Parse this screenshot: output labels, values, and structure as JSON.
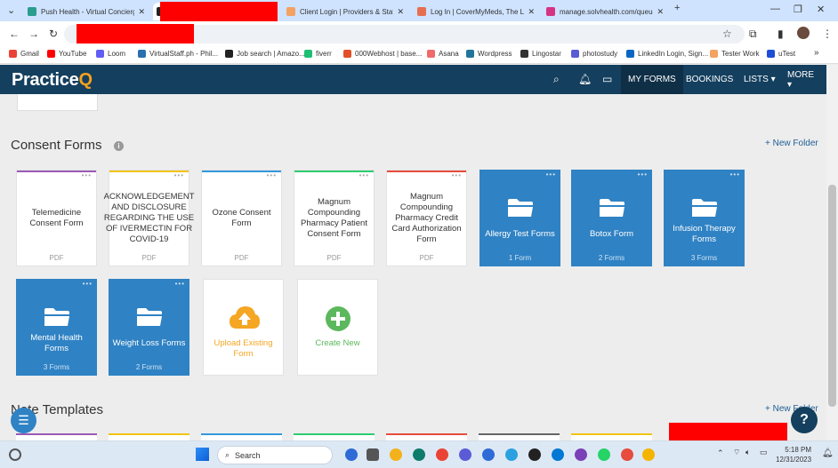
{
  "browser": {
    "tabs": [
      {
        "title": "Push Health - Virtual Concierge",
        "color": "#2a9d8f",
        "active": false
      },
      {
        "title": "",
        "color": "#222222",
        "active": true
      },
      {
        "title": "Client Login | Providers & Staff",
        "color": "#f4a261",
        "active": false
      },
      {
        "title": "Log In | CoverMyMeds, The Lea",
        "color": "#e76f51",
        "active": false
      },
      {
        "title": "manage.solvhealth.com/queue",
        "color": "#d63384",
        "active": false
      }
    ],
    "new_tab": "+",
    "bookmarks": [
      {
        "label": "Gmail",
        "color": "#ea4335"
      },
      {
        "label": "YouTube",
        "color": "#ff0000"
      },
      {
        "label": "Loom",
        "color": "#625df5"
      },
      {
        "label": "VirtualStaff.ph - Phil...",
        "color": "#2a6fb0"
      },
      {
        "label": "Job search | Amazo...",
        "color": "#222222"
      },
      {
        "label": "fiverr",
        "color": "#1dbf73"
      },
      {
        "label": "000Webhost | base...",
        "color": "#e34f26"
      },
      {
        "label": "Asana",
        "color": "#f06a6a"
      },
      {
        "label": "Wordpress",
        "color": "#21759b"
      },
      {
        "label": "Lingostar",
        "color": "#333333"
      },
      {
        "label": "photostudy",
        "color": "#5b5bd6"
      },
      {
        "label": "LinkedIn Login, Sign...",
        "color": "#0a66c2"
      },
      {
        "label": "Tester Work",
        "color": "#f4a261"
      },
      {
        "label": "uTest",
        "color": "#1c4fd6"
      }
    ],
    "bookmarks_more": "»"
  },
  "app": {
    "logo_main": "Practice",
    "logo_accent": "Q",
    "nav": [
      "MY FORMS",
      "BOOKINGS",
      "LISTS ▾",
      "MORE ▾"
    ],
    "active_nav": "MY FORMS"
  },
  "consent": {
    "title": "Consent Forms",
    "info": "i",
    "new_folder": "+ New Folder",
    "forms": [
      {
        "title": "Telemedicine Consent Form",
        "type": "PDF",
        "accent": "#9b59b6"
      },
      {
        "title": "ACKNOWLEDGEMENT AND DISCLOSURE REGARDING THE USE OF IVERMECTIN FOR COVID-19",
        "type": "PDF",
        "accent": "#f1c40f"
      },
      {
        "title": "Ozone Consent Form",
        "type": "PDF",
        "accent": "#3498db"
      },
      {
        "title": "Magnum Compounding Pharmacy Patient Consent Form",
        "type": "PDF",
        "accent": "#2ecc71"
      },
      {
        "title": "Magnum Compounding Pharmacy Credit Card Authorization Form",
        "type": "PDF",
        "accent": "#e74c3c"
      }
    ],
    "folders": [
      {
        "title": "Allergy Test Forms",
        "count": "1 Form"
      },
      {
        "title": "Botox Form",
        "count": "2 Forms"
      },
      {
        "title": "Infusion Therapy Forms",
        "count": "3 Forms"
      },
      {
        "title": "Mental Health Forms",
        "count": "3 Forms"
      },
      {
        "title": "Weight Loss Forms",
        "count": "2 Forms"
      }
    ],
    "upload_label": "Upload Existing Form",
    "create_label": "Create New"
  },
  "notes": {
    "title": "Note Templates",
    "new_folder": "+ New Folder"
  },
  "taskbar": {
    "search": "Search",
    "time": "5:18 PM",
    "date": "12/31/2023"
  }
}
